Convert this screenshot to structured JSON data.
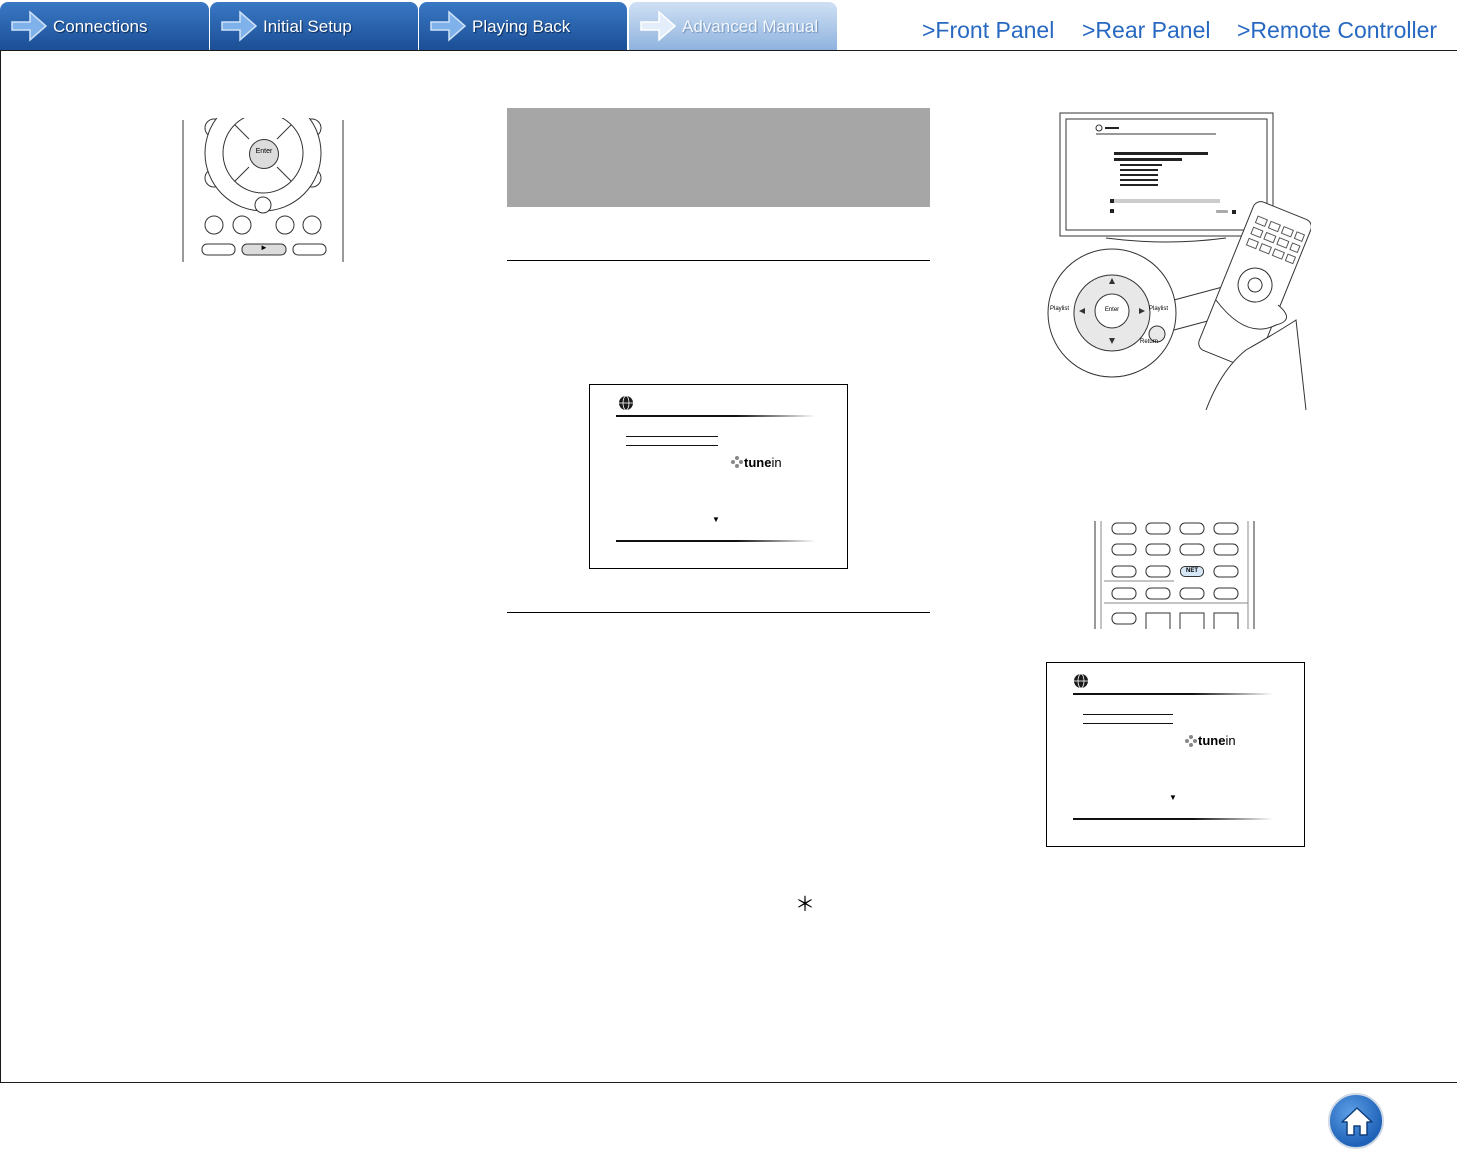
{
  "tabs": [
    {
      "label": "Connections"
    },
    {
      "label": "Initial Setup"
    },
    {
      "label": "Playing Back"
    },
    {
      "label": "Advanced Manual"
    }
  ],
  "links": {
    "front_panel": ">Front Panel",
    "rear_panel": ">Rear Panel",
    "remote_controller": ">Remote Controller"
  },
  "remote_top": {
    "enter": "Enter",
    "play": "►"
  },
  "tv_illustration": {
    "left_button": "Playlist",
    "right_button": "Playlist",
    "center_button": "Enter",
    "return_button": "Return"
  },
  "remote_net": {
    "net": "NET"
  },
  "tunein_screen_1": {
    "logo_text": "tune",
    "logo_suffix": "in",
    "arrow": "▼"
  },
  "tunein_screen_2": {
    "logo_text": "tune",
    "logo_suffix": "in",
    "arrow": "▼"
  },
  "footnote_mark": "＊",
  "colors": {
    "tab_blue": "#1b4f96",
    "tab_active": "#8fb3de",
    "link_blue": "#2769c2",
    "grey_header": "#a6a6a6",
    "home_blue": "#1f62b8"
  }
}
